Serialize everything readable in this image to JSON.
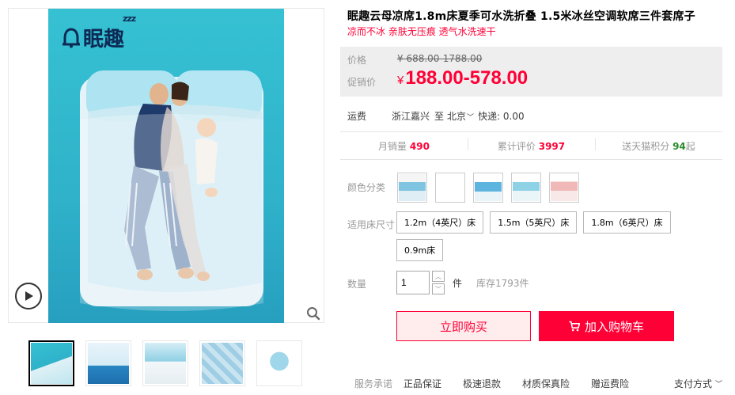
{
  "gallery": {
    "logo_text": "眠趣",
    "logo_z": "zzz",
    "thumbnails": [
      {
        "alt": "thumb-1"
      },
      {
        "alt": "thumb-2"
      },
      {
        "alt": "thumb-3"
      },
      {
        "alt": "thumb-4"
      },
      {
        "alt": "thumb-5"
      }
    ]
  },
  "product": {
    "title": "眠趣云母凉席1.8m床夏季可水洗折叠 1.5米冰丝空调软席三件套席子",
    "subtitle": "凉而不冰 亲肤无压痕 透气水洗速干"
  },
  "price": {
    "label": "价格",
    "original": "¥ 688.00-1788.00",
    "promo_label": "促销价",
    "currency": "¥",
    "promo": "188.00-578.00"
  },
  "shipping": {
    "label": "运费",
    "from": "浙江嘉兴",
    "to_prefix": "至",
    "to": "北京",
    "express": "快递: 0.00"
  },
  "stats": {
    "monthly_label": "月销量",
    "monthly": "490",
    "reviews_label": "累计评价",
    "reviews": "3997",
    "points_label": "送天猫积分",
    "points": "94",
    "points_suffix": "起"
  },
  "color": {
    "label": "颜色分类",
    "swatches": [
      "swatch-1",
      "swatch-2",
      "swatch-3",
      "swatch-4",
      "swatch-5"
    ]
  },
  "size": {
    "label": "适用床尺寸",
    "options": [
      "1.2m（4英尺）床",
      "1.5m（5英尺）床",
      "1.8m（6英尺）床",
      "0.9m床"
    ]
  },
  "quantity": {
    "label": "数量",
    "value": "1",
    "unit": "件",
    "stock": "库存1793件"
  },
  "actions": {
    "buy_now": "立即购买",
    "add_cart": "加入购物车"
  },
  "service": {
    "label": "服务承诺",
    "items": [
      "正品保证",
      "极速退款",
      "材质保真险",
      "赠运费险"
    ],
    "pay_label": "支付方式"
  },
  "colors": {
    "accent": "#ff0036",
    "price_bg": "#eeeeee",
    "buy_bg": "#ffeded",
    "image_bg": "#36c1d3",
    "logo": "#0d2a55",
    "green": "#2a8a2a"
  }
}
